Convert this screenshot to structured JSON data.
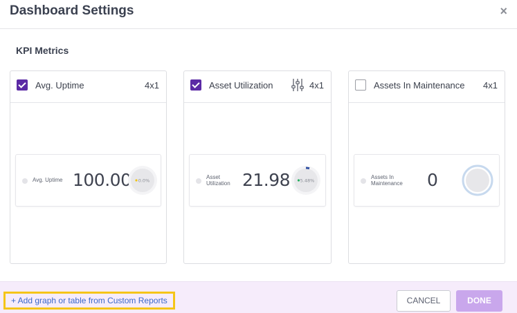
{
  "dialog": {
    "title": "Dashboard Settings",
    "close_glyph": "×"
  },
  "section": {
    "title": "KPI Metrics"
  },
  "cards": [
    {
      "label": "Avg. Uptime",
      "size": "4x1",
      "checked": true,
      "preview_label": "Avg. Uptime",
      "preview_value": "100.00",
      "gauge_text": "0.0%",
      "gauge_color": "#f0c419"
    },
    {
      "label": "Asset Utilization",
      "size": "4x1",
      "checked": true,
      "has_settings_icon": true,
      "preview_label_line1": "Asset",
      "preview_label_line2": "Utilization",
      "preview_value": "21.98",
      "gauge_text": "5.48%",
      "gauge_color": "#27ae60",
      "gauge_arc_color": "#2f4fa2"
    },
    {
      "label": "Assets In Maintenance",
      "size": "4x1",
      "checked": false,
      "preview_label_line1": "Assets In",
      "preview_label_line2": "Maintenance",
      "preview_value": "0",
      "gauge_ring_color": "#c7d9ee"
    }
  ],
  "footer": {
    "add_link": "+ Add graph or table from Custom Reports",
    "cancel_label": "CANCEL",
    "done_label": "DONE"
  },
  "colors": {
    "accent": "#5b2aa5",
    "highlight": "#f5c518",
    "link": "#3a68c9",
    "done_disabled": "#c9a7ec",
    "footer_bg": "#f6ecfb"
  }
}
